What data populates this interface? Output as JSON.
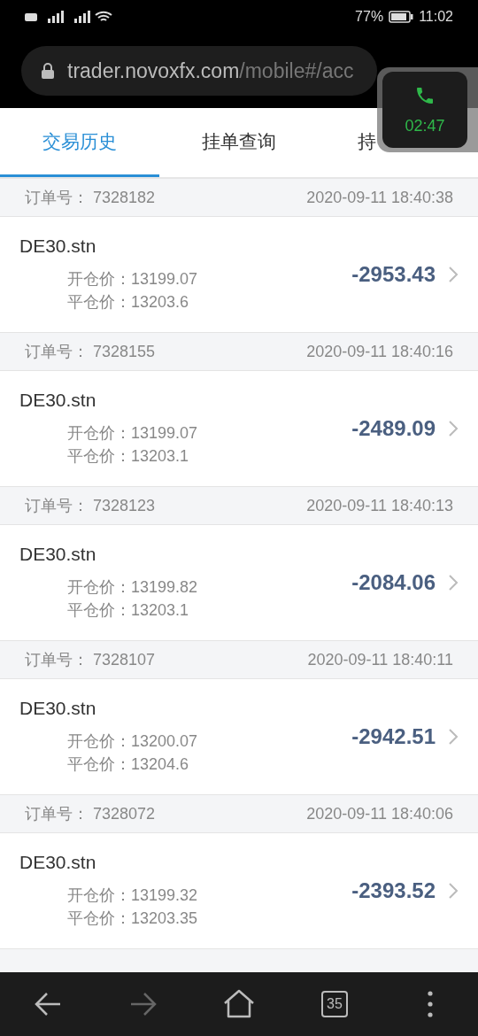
{
  "status_bar": {
    "battery_percent": "77%",
    "time": "11:02"
  },
  "browser": {
    "url_host": "trader.novoxfx.com",
    "url_path": "/mobile#/acc"
  },
  "call_overlay": {
    "duration": "02:47"
  },
  "tabs": [
    {
      "label": "交易历史",
      "selected": true
    },
    {
      "label": "挂单查询",
      "selected": false
    },
    {
      "label": "持",
      "selected": false
    }
  ],
  "orders": [
    {
      "order_label": "订单号：",
      "order_no": "7328182",
      "time": "2020-09-11 18:40:38",
      "symbol": "DE30.stn",
      "open_label": "开仓价：",
      "open_price": "13199.07",
      "close_label": "平仓价：",
      "close_price": "13203.6",
      "profit": "-2953.43"
    },
    {
      "order_label": "订单号：",
      "order_no": "7328155",
      "time": "2020-09-11 18:40:16",
      "symbol": "DE30.stn",
      "open_label": "开仓价：",
      "open_price": "13199.07",
      "close_label": "平仓价：",
      "close_price": "13203.1",
      "profit": "-2489.09"
    },
    {
      "order_label": "订单号：",
      "order_no": "7328123",
      "time": "2020-09-11 18:40:13",
      "symbol": "DE30.stn",
      "open_label": "开仓价：",
      "open_price": "13199.82",
      "close_label": "平仓价：",
      "close_price": "13203.1",
      "profit": "-2084.06"
    },
    {
      "order_label": "订单号：",
      "order_no": "7328107",
      "time": "2020-09-11 18:40:11",
      "symbol": "DE30.stn",
      "open_label": "开仓价：",
      "open_price": "13200.07",
      "close_label": "平仓价：",
      "close_price": "13204.6",
      "profit": "-2942.51"
    },
    {
      "order_label": "订单号：",
      "order_no": "7328072",
      "time": "2020-09-11 18:40:06",
      "symbol": "DE30.stn",
      "open_label": "开仓价：",
      "open_price": "13199.32",
      "close_label": "平仓价：",
      "close_price": "13203.35",
      "profit": "-2393.52"
    }
  ],
  "nav_bar": [
    {
      "kind": "back",
      "disabled": false
    },
    {
      "kind": "forward",
      "disabled": true
    },
    {
      "kind": "home",
      "disabled": false
    },
    {
      "kind": "tabs",
      "label": "35",
      "disabled": false
    },
    {
      "kind": "menu",
      "disabled": false
    }
  ]
}
